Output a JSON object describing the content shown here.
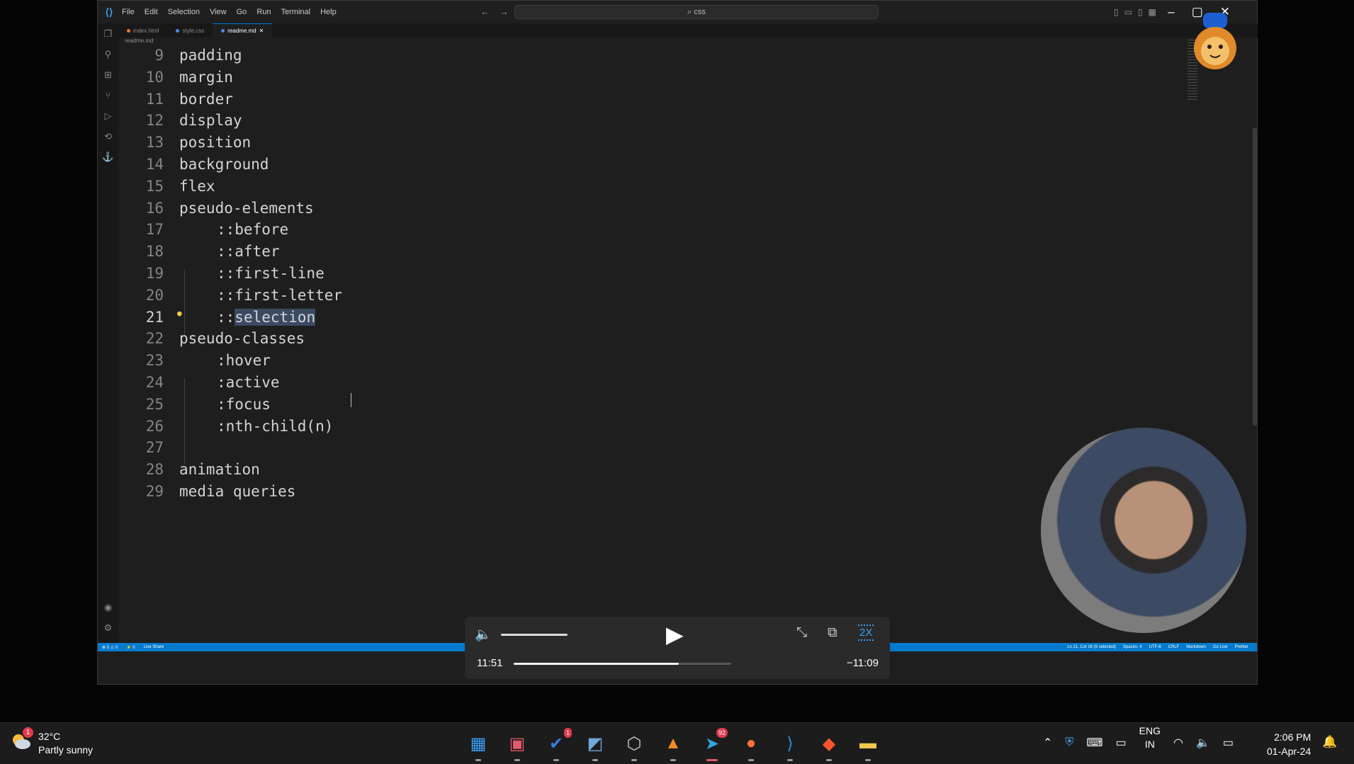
{
  "window": {
    "menu": [
      "File",
      "Edit",
      "Selection",
      "View",
      "Go",
      "Run",
      "Terminal",
      "Help"
    ],
    "search_text": "⌕ css",
    "tabs": [
      {
        "label": "index.html",
        "active": false
      },
      {
        "label": "style.css",
        "active": false
      },
      {
        "label": "readme.md",
        "active": true
      }
    ],
    "breadcrumb": "readme.md",
    "activity_icons": [
      "files-icon",
      "search-icon",
      "extensions-icon",
      "source-control-icon",
      "run-debug-icon",
      "remote-icon",
      "anchor-icon"
    ]
  },
  "editor": {
    "lines": [
      {
        "n": "9",
        "text": "padding",
        "indent": false
      },
      {
        "n": "10",
        "text": "margin",
        "indent": false
      },
      {
        "n": "11",
        "text": "border",
        "indent": false
      },
      {
        "n": "12",
        "text": "display",
        "indent": false
      },
      {
        "n": "13",
        "text": "position",
        "indent": false
      },
      {
        "n": "14",
        "text": "background",
        "indent": false
      },
      {
        "n": "15",
        "text": "flex",
        "indent": false
      },
      {
        "n": "16",
        "text": "pseudo-elements",
        "indent": false
      },
      {
        "n": "17",
        "text": "::before",
        "indent": true
      },
      {
        "n": "18",
        "text": "::after",
        "indent": true
      },
      {
        "n": "19",
        "text": "::first-line",
        "indent": true
      },
      {
        "n": "20",
        "text": "::first-letter",
        "indent": true
      },
      {
        "n": "21",
        "text_prefix": "::",
        "text_selected": "selection",
        "indent": true,
        "current": true
      },
      {
        "n": "22",
        "text": "pseudo-classes",
        "indent": false
      },
      {
        "n": "23",
        "text": ":hover",
        "indent": true
      },
      {
        "n": "24",
        "text": ":active",
        "indent": true
      },
      {
        "n": "25",
        "text": ":focus",
        "indent": true
      },
      {
        "n": "26",
        "text": ":nth-child(n)",
        "indent": true
      },
      {
        "n": "27",
        "text": "",
        "indent": false
      },
      {
        "n": "28",
        "text": "animation",
        "indent": false
      },
      {
        "n": "29",
        "text": "media queries",
        "indent": false
      }
    ]
  },
  "statusbar": {
    "left": [
      "⊗ 0 ⚠ 0",
      "⚡ 0",
      "Live Share"
    ],
    "right": [
      "Ln 21, Col 16 (9 selected)",
      "Spaces: 4",
      "UTF-8",
      "CRLF",
      "Markdown",
      "Go Live",
      "Prettier"
    ]
  },
  "player": {
    "time_elapsed": "11:51",
    "time_remaining": "−11:09",
    "speed": "2X",
    "progress": 0.76,
    "volume": 1.0
  },
  "taskbar": {
    "weather": {
      "temp": "32°C",
      "desc": "Partly sunny",
      "badge": "1"
    },
    "apps": [
      {
        "name": "start-icon",
        "glyph": "▦",
        "color": "#3aa0f3"
      },
      {
        "name": "calendar-app-icon",
        "glyph": "▣",
        "color": "#e05a6b"
      },
      {
        "name": "todo-app-icon",
        "glyph": "✔",
        "color": "#3b7ddd",
        "badge": "1"
      },
      {
        "name": "monitor-app-icon",
        "glyph": "◩",
        "color": "#6fa8dc"
      },
      {
        "name": "unity-app-icon",
        "glyph": "⬡",
        "color": "#cccccc"
      },
      {
        "name": "vlc-app-icon",
        "glyph": "▲",
        "color": "#f08a24"
      },
      {
        "name": "telegram-app-icon",
        "glyph": "➤",
        "color": "#2ea6e0",
        "badge": "92",
        "active": true
      },
      {
        "name": "firefox-app-icon",
        "glyph": "●",
        "color": "#ff7139"
      },
      {
        "name": "vscode-app-icon",
        "glyph": "⟩",
        "color": "#2d8ee0"
      },
      {
        "name": "brave-app-icon",
        "glyph": "◆",
        "color": "#fb542b"
      },
      {
        "name": "file-explorer-app-icon",
        "glyph": "▬",
        "color": "#f2c94c"
      }
    ],
    "tray": {
      "lang_top": "ENG",
      "lang_bottom": "IN"
    },
    "clock": {
      "time": "2:06 PM",
      "date": "01-Apr-24"
    }
  }
}
